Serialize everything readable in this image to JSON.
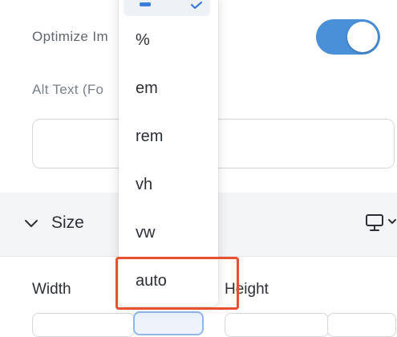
{
  "image_settings": {
    "optimize_label": "Optimize Im",
    "optimize_enabled": true,
    "alt_text_label": "Alt Text (Fo",
    "alt_text_value": ""
  },
  "size_section": {
    "title": "Size",
    "device_icon": "monitor-icon",
    "width_label": "Width",
    "height_label": "Height"
  },
  "unit_dropdown": {
    "options": [
      "%",
      "em",
      "rem",
      "vh",
      "vw",
      "auto"
    ],
    "highlighted_option": "auto"
  },
  "colors": {
    "toggle_on": "#4a90d9",
    "highlight": "#e8502f",
    "selected_accent": "#3b7ddd"
  }
}
